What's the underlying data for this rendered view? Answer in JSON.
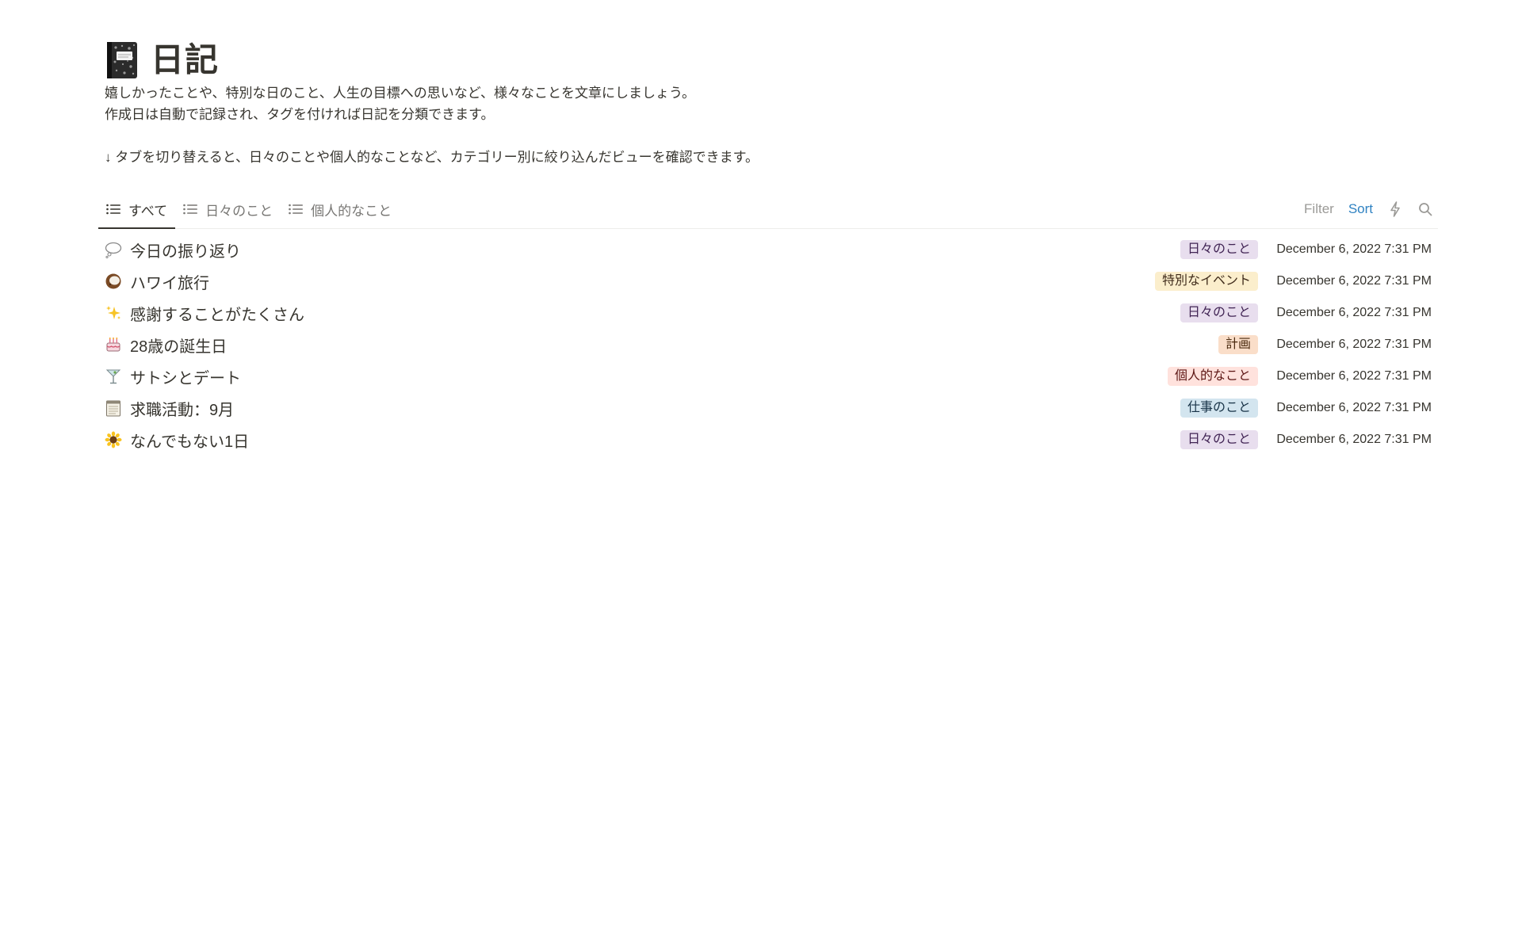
{
  "page": {
    "icon": "notebook-icon",
    "title": "日記",
    "description": [
      "嬉しかったことや、特別な日のこと、人生の目標への思いなど、様々なことを文章にしましょう。",
      "作成日は自動で記録され、タグを付ければ日記を分類できます。",
      "↓ タブを切り替えると、日々のことや個人的なことなど、カテゴリー別に絞り込んだビューを確認できます。"
    ]
  },
  "tabs": [
    {
      "label": "すべて",
      "icon": "list-icon",
      "active": true
    },
    {
      "label": "日々のこと",
      "icon": "list-icon",
      "active": false
    },
    {
      "label": "個人的なこと",
      "icon": "list-icon",
      "active": false
    }
  ],
  "toolbar": {
    "filter_label": "Filter",
    "sort_label": "Sort",
    "automation_icon": "lightning-icon",
    "search_icon": "search-icon"
  },
  "tag_colors": {
    "日々のこと": {
      "bg": "#e8deee",
      "fg": "#412454"
    },
    "特別なイベント": {
      "bg": "#fbeecc",
      "fg": "#402c1b"
    },
    "計画": {
      "bg": "#fadec9",
      "fg": "#49290e"
    },
    "個人的なこと": {
      "bg": "#ffe2dd",
      "fg": "#5d1715"
    },
    "仕事のこと": {
      "bg": "#d3e5ef",
      "fg": "#183347"
    }
  },
  "entries": [
    {
      "emoji": "thought-balloon-icon",
      "title": "今日の振り返り",
      "tag": "日々のこと",
      "date": "December 6, 2022 7:31 PM"
    },
    {
      "emoji": "coconut-icon",
      "title": "ハワイ旅行",
      "tag": "特別なイベント",
      "date": "December 6, 2022 7:31 PM"
    },
    {
      "emoji": "sparkles-icon",
      "title": "感謝することがたくさん",
      "tag": "日々のこと",
      "date": "December 6, 2022 7:31 PM"
    },
    {
      "emoji": "birthday-cake-icon",
      "title": "28歳の誕生日",
      "tag": "計画",
      "date": "December 6, 2022 7:31 PM"
    },
    {
      "emoji": "cocktail-glass-icon",
      "title": "サトシとデート",
      "tag": "個人的なこと",
      "date": "December 6, 2022 7:31 PM"
    },
    {
      "emoji": "notepad-icon",
      "title": "求職活動：9月",
      "tag": "仕事のこと",
      "date": "December 6, 2022 7:31 PM"
    },
    {
      "emoji": "sunflower-icon",
      "title": "なんでもない1日",
      "tag": "日々のこと",
      "date": "December 6, 2022 7:31 PM"
    }
  ]
}
